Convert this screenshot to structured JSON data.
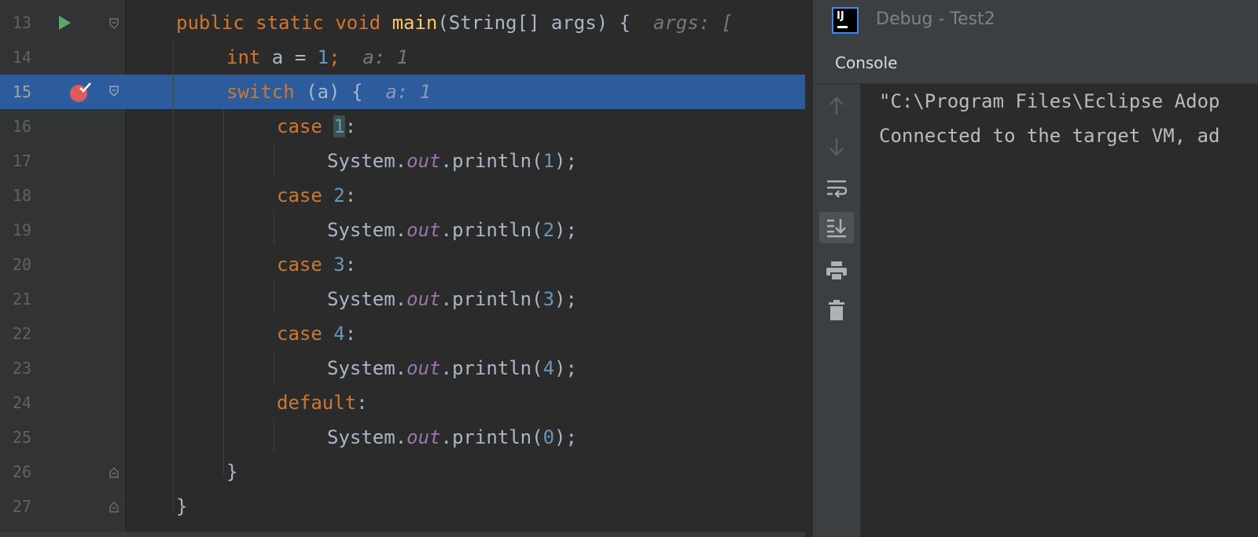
{
  "editor": {
    "lines": [
      {
        "num": "13",
        "kind": "main"
      },
      {
        "num": "14",
        "kind": "int"
      },
      {
        "num": "15",
        "kind": "switch"
      },
      {
        "num": "16",
        "kind": "case",
        "label": "1"
      },
      {
        "num": "17",
        "kind": "println",
        "arg": "1"
      },
      {
        "num": "18",
        "kind": "case",
        "label": "2"
      },
      {
        "num": "19",
        "kind": "println",
        "arg": "2"
      },
      {
        "num": "20",
        "kind": "case",
        "label": "3"
      },
      {
        "num": "21",
        "kind": "println",
        "arg": "3"
      },
      {
        "num": "22",
        "kind": "case",
        "label": "4"
      },
      {
        "num": "23",
        "kind": "println",
        "arg": "4"
      },
      {
        "num": "24",
        "kind": "default"
      },
      {
        "num": "25",
        "kind": "println",
        "arg": "0"
      },
      {
        "num": "26",
        "kind": "closeswitch"
      },
      {
        "num": "27",
        "kind": "closemain"
      }
    ],
    "tokens": {
      "public": "public",
      "static": "static",
      "void": "void",
      "main": "main",
      "string_args": "(String[] args) {",
      "hint_args": "args: [",
      "int_kw": "int",
      "int_rest": " a = ",
      "int_val": "1",
      "semi": ";",
      "hint_a": "a: 1",
      "switch_kw": "switch",
      "switch_rest": " (a) {",
      "case_kw": "case",
      "colon": ":",
      "system": "System.",
      "out": "out",
      "println_open": ".println(",
      "println_close": ");",
      "default_kw": "default",
      "close_brace": "}"
    },
    "highlighted_line": "15"
  },
  "gutter": {
    "run_icon": "run-arrow-icon",
    "breakpoint_icon": "breakpoint-verified-icon",
    "fold_icon": "fold-marker-icon"
  },
  "debug_panel": {
    "title": "Debug - Test2",
    "logo_text": "IJ",
    "tab_console": "Console",
    "toolbar": [
      {
        "icon": "up-arrow-icon"
      },
      {
        "icon": "down-arrow-icon"
      },
      {
        "icon": "soft-wrap-icon"
      },
      {
        "icon": "scroll-to-end-icon",
        "active": true
      },
      {
        "icon": "print-icon"
      },
      {
        "icon": "trash-icon"
      }
    ],
    "console_lines": [
      "\"C:\\Program Files\\Eclipse Adop",
      "Connected to the target VM, ad"
    ]
  },
  "colors": {
    "keyword": "#cc7832",
    "function": "#ffc66d",
    "number": "#6897bb",
    "field": "#9876aa",
    "highlight": "#2c5b9e"
  }
}
